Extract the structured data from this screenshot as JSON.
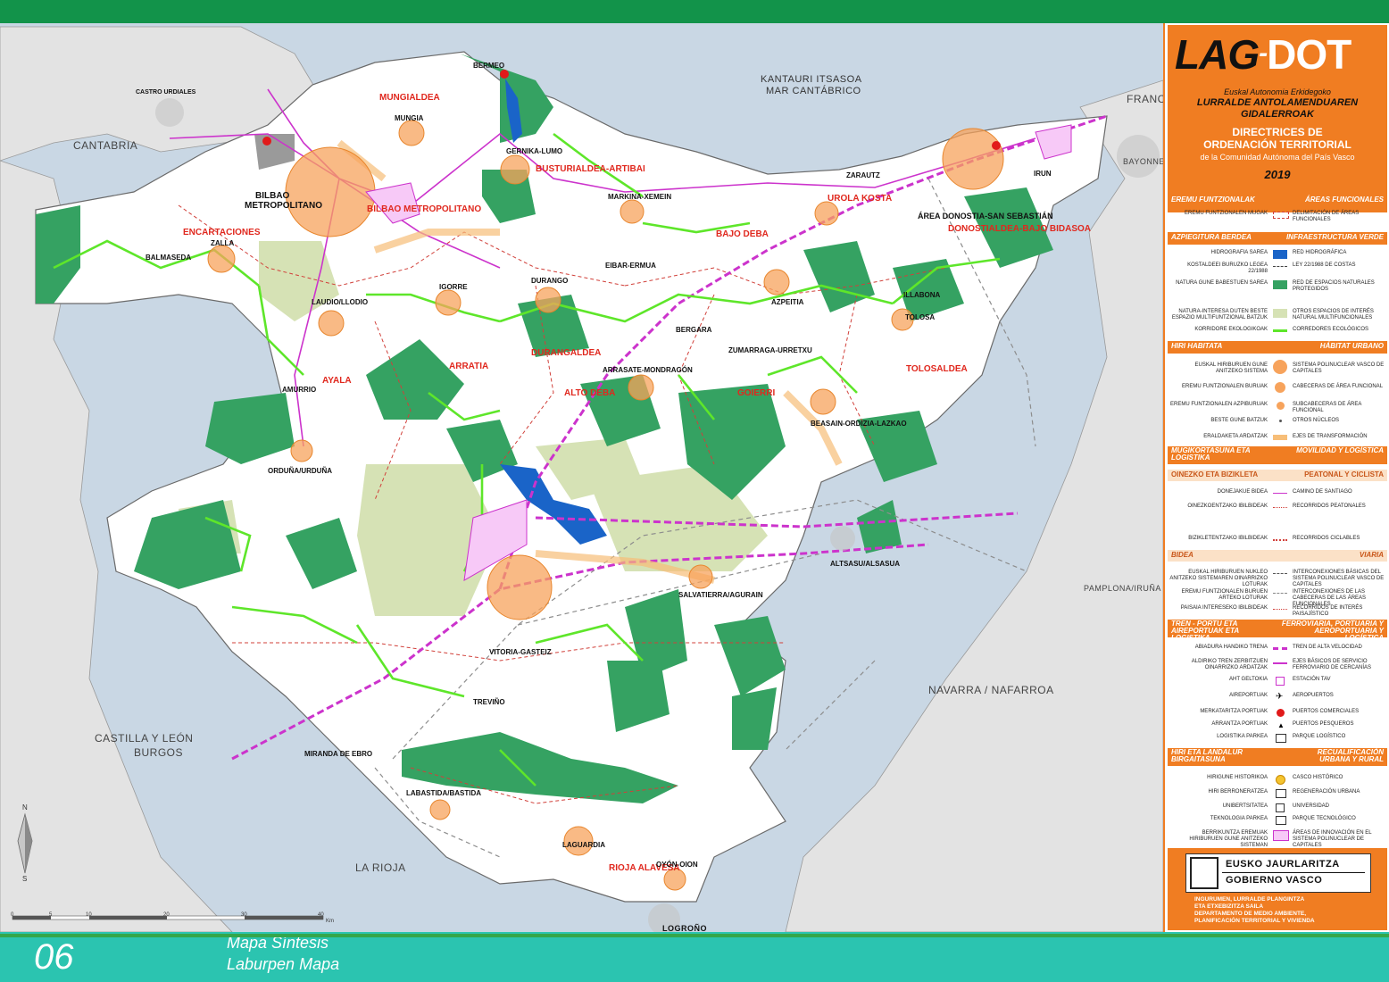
{
  "map": {
    "regions": {
      "cantabria": "CANTABRIA",
      "francia": "FRANCIA",
      "castilla": "CASTILLA Y LEÓN",
      "burgos": "BURGOS",
      "navarra": "NAVARRA / NAFARROA",
      "la_rioja": "LA RIOJA",
      "pamplona": "PAMPLONA/IRUÑA",
      "bayonne": "BAYONNE",
      "logrono": "LOGROÑO"
    },
    "sea_eu": "KANTAURI ITSASOA",
    "sea_es": "MAR CANTÁBRICO",
    "functional_areas": {
      "mungialdea": "MUNGIALDEA",
      "busturialdea": "BUSTURIALDEA-ARTIBAI",
      "bilbao_metro": "BILBAO METROPOLITANO",
      "encartaciones": "ENCARTACIONES",
      "urola": "UROLA KOSTA",
      "donostia": "ÁREA DONOSTIA-SAN SEBASTIÁN",
      "bidasoa": "DONOSTIALDEA-BAJO BIDASOA",
      "bajo_deba": "BAJO DEBA",
      "durangaldea": "DURANGALDEA",
      "ayala": "AYALA",
      "arratia": "ARRATIA",
      "alto_deba": "ALTO DEBA",
      "goierri": "GOIERRI",
      "tolosaldea": "TOLOSALDEA",
      "rioja_alavesa": "RIOJA ALAVESA"
    },
    "towns": {
      "castro": "CASTRO URDIALES",
      "bermeo": "BERMEO",
      "mungia": "MUNGIA",
      "gernika": "GERNIKA-LUMO",
      "bilbao": "BILBAO",
      "metropolitano": "METROPOLITANO",
      "zalla": "ZALLA",
      "balmaseda": "BALMASEDA",
      "markina": "MARKINA-XEMEIN",
      "zarautz": "ZARAUTZ",
      "irun": "IRUN",
      "eibar": "EIBAR-ERMUA",
      "durango": "DURANGO",
      "igorre": "IGORRE",
      "laudio": "LAUDIO/LLODIO",
      "azpeitia": "AZPEITIA",
      "bergara": "BERGARA",
      "zumarraga": "ZUMARRAGA-URRETXU",
      "arrasate": "ARRASATE-MONDRAGÓN",
      "tolosa": "TOLOSA",
      "amurrio": "AMURRIO",
      "beasain": "BEASAIN-ORDIZIA-LAZKAO",
      "orduna": "ORDUÑA/URDUÑA",
      "altsasu": "ALTSASU/ALSASUA",
      "salvatierra": "SALVATIERRA/AGURAIN",
      "vitoria": "VITORIA-GASTEIZ",
      "trevino": "TREVIÑO",
      "miranda": "MIRANDA DE EBRO",
      "labastida": "LABASTIDA/BASTIDA",
      "laguardia": "LAGUARDIA",
      "oyon": "OYÓN-OION",
      "labbona": "ILLABONA"
    },
    "scale": {
      "ticks": [
        "0",
        "5",
        "10",
        "20",
        "30",
        "40"
      ],
      "unit": "Km"
    },
    "north": "N",
    "south": "S"
  },
  "legend": {
    "logo_main": "LAG",
    "logo_dash": "-",
    "logo_dot": "DOT",
    "eu_sub": "Euskal Autonomia Erkidegoko",
    "eu_title1": "LURRALDE ANTOLAMENDUAREN",
    "eu_title2": "GIDALERROAK",
    "es_title1": "DIRECTRICES DE",
    "es_title2": "ORDENACIÓN TERRITORIAL",
    "es_sub": "de la Comunidad Autónoma del País Vasco",
    "year": "2019",
    "sections": [
      {
        "eu": "EREMU FUNTZIONALAK",
        "es": "ÁREAS FUNCIONALES"
      },
      {
        "eu": "AZPIEGITURA BERDEA",
        "es": "INFRAESTRUCTURA VERDE"
      },
      {
        "eu": "HIRI HABITATA",
        "es": "HÁBITAT URBANO"
      },
      {
        "eu": "MUGIKORTASUNA ETA LOGISTIKA",
        "es": "MOVILIDAD Y LOGÍSTICA"
      },
      {
        "eu": "TREN - PORTU ETA AIREPORTUAK ETA LOGISTIKA",
        "es": "FERROVIARIA, PORTUARIA Y AEROPORTUARIA Y LOGÍSTICA"
      },
      {
        "eu": "HIRI ETA LANDALUR BIRGAITASUNA",
        "es": "RECUALIFICACIÓN URBANA Y RURAL"
      }
    ],
    "subsections": [
      {
        "eu": "OINEZKO ETA BIZIKLETA",
        "es": "PEATONAL Y CICLISTA"
      },
      {
        "eu": "BIDEA",
        "es": "VIARIA"
      }
    ],
    "items": [
      {
        "eu": "EREMU FUNTZIONALEN MUGAK",
        "es": "DELIMITACIÓN DE ÁREAS FUNCIONALES"
      },
      {
        "eu": "HIDROGRAFIA SAREA",
        "es": "RED HIDROGRÁFICA"
      },
      {
        "eu": "KOSTALDEEI BURUZKO LEGEA 22/1988",
        "es": "LEY 22/1988 DE COSTAS"
      },
      {
        "eu": "NATURA GUNE BABESTUEN SAREA",
        "es": "RED DE ESPACIOS NATURALES PROTEGIDOS"
      },
      {
        "eu": "NATURA-INTERESA DUTEN BESTE ESPAZIO MULTIFUNTZIONAL BATZUK",
        "es": "OTROS ESPACIOS DE INTERÉS NATURAL MULTIFUNCIONALES"
      },
      {
        "eu": "KORRIDORE EKOLOGIKOAK",
        "es": "CORREDORES ECOLÓGICOS"
      },
      {
        "eu": "EUSKAL HIRIBURUEN GUNE ANITZEKO SISTEMA",
        "es": "SISTEMA POLINUCLEAR VASCO DE CAPITALES"
      },
      {
        "eu": "EREMU FUNTZIONALEN BURUAK",
        "es": "CABECERAS DE ÁREA FUNCIONAL"
      },
      {
        "eu": "EREMU FUNTZIONALEN AZPIBURUAK",
        "es": "SUBCABECERAS DE ÁREA FUNCIONAL"
      },
      {
        "eu": "BESTE GUNE BATZUK",
        "es": "OTROS NÚCLEOS"
      },
      {
        "eu": "ERALDAKETA ARDATZAK",
        "es": "EJES DE TRANSFORMACIÓN"
      },
      {
        "eu": "DONEJAKUE BIDEA",
        "es": "CAMINO DE SANTIAGO"
      },
      {
        "eu": "OINEZKOENTZAKO IBILBIDEAK",
        "es": "RECORRIDOS PEATONALES"
      },
      {
        "eu": "BIZIKLETENTZAKO IBILBIDEAK",
        "es": "RECORRIDOS CICLABLES"
      },
      {
        "eu": "EUSKAL HIRIBURUEN NUKLEO ANITZEKO SISTEMAREN OINARRIZKO LOTURAK",
        "es": "INTERCONEXIONES BÁSICAS DEL SISTEMA POLINUCLEAR VASCO DE CAPITALES"
      },
      {
        "eu": "EREMU FUNTZIONALEN BURUEN ARTEKO LOTURAK",
        "es": "INTERCONEXIONES DE LAS CABECERAS DE LAS ÁREAS FUNCIONALES"
      },
      {
        "eu": "PAISAIA INTERESEKO IBILBIDEAK",
        "es": "RECORRIDOS DE INTERÉS PAISAJÍSTICO"
      },
      {
        "eu": "ABIADURA HANDIKO TRENA",
        "es": "TREN DE ALTA VELOCIDAD"
      },
      {
        "eu": "ALDIRIKO TREN ZERBITZUEN OINARRIZKO ARDATZAK",
        "es": "EJES BÁSICOS DE SERVICIO FERROVIARIO DE CERCANÍAS"
      },
      {
        "eu": "AHT GELTOKIA",
        "es": "ESTACIÓN TAV"
      },
      {
        "eu": "AIREPORTUAK",
        "es": "AEROPUERTOS"
      },
      {
        "eu": "MERKATARITZA PORTUAK",
        "es": "PUERTOS COMERCIALES"
      },
      {
        "eu": "ARRANTZA PORTUAK",
        "es": "PUERTOS PESQUEROS"
      },
      {
        "eu": "LOGISTIKA PARKEA",
        "es": "PARQUE LOGÍSTICO"
      },
      {
        "eu": "HIRIGUNE HISTORIKOA",
        "es": "CASCO HISTÓRICO"
      },
      {
        "eu": "HIRI BERRONERATZEA",
        "es": "REGENERACIÓN URBANA"
      },
      {
        "eu": "UNIBERTSITATEA",
        "es": "UNIVERSIDAD"
      },
      {
        "eu": "TEKNOLOGIA PARKEA",
        "es": "PARQUE TECNOLÓGICO"
      },
      {
        "eu": "BERRIKUNTZA EREMUAK HIRIBURUEN GUNE ANITZEKO SISTEMAN",
        "es": "ÁREAS DE INNOVACIÓN EN EL SISTEMA POLINUCLEAR DE CAPITALES"
      }
    ],
    "gov_eu": "EUSKO JAURLARITZA",
    "gov_es": "GOBIERNO VASCO",
    "dept": [
      "INGURUMEN, LURRALDE PLANGINTZA",
      "ETA ETXEBIZITZA SAILA",
      "DEPARTAMENTO DE MEDIO AMBIENTE,",
      "PLANIFICACIÓN TERRITORIAL Y VIVIENDA"
    ]
  },
  "footer": {
    "number": "06",
    "title_es": "Mapa Síntesis",
    "title_eu": "Laburpen Mapa"
  },
  "colors": {
    "header_green": "#12934a",
    "accent_orange": "#f07d22",
    "footer_teal": "#2bc4b0",
    "sea": "#c9d7e4",
    "natural_spaces": "#35a262",
    "other_natural": "#d6e2b5",
    "corridors": "#5ee62a",
    "rail": "#cc33cc",
    "area_label_red": "#e0281e"
  }
}
